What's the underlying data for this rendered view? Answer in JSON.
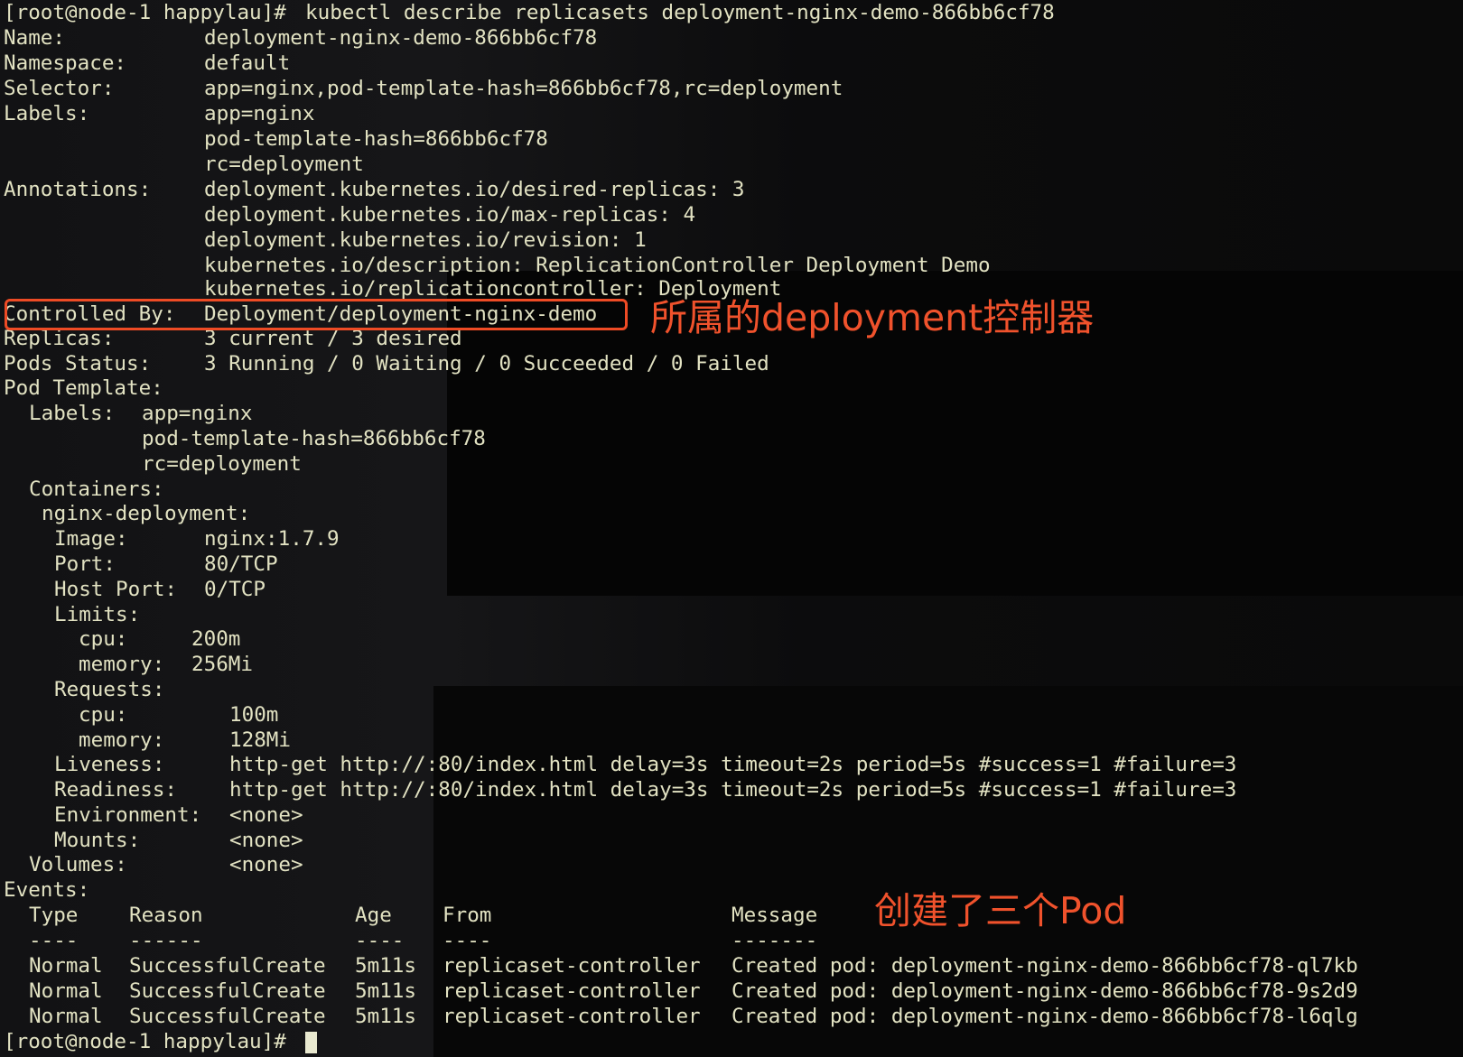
{
  "prompt": "[root@node-1 happylau]# ",
  "command": "kubectl describe replicasets deployment-nginx-demo-866bb6cf78",
  "name_key": "Name:",
  "name_val": "deployment-nginx-demo-866bb6cf78",
  "namespace_key": "Namespace:",
  "namespace_val": "default",
  "selector_key": "Selector:",
  "selector_val": "app=nginx,pod-template-hash=866bb6cf78,rc=deployment",
  "labels_key": "Labels:",
  "labels": [
    "app=nginx",
    "pod-template-hash=866bb6cf78",
    "rc=deployment"
  ],
  "annotations_key": "Annotations:",
  "annotations": [
    "deployment.kubernetes.io/desired-replicas: 3",
    "deployment.kubernetes.io/max-replicas: 4",
    "deployment.kubernetes.io/revision: 1",
    "kubernetes.io/description: ReplicationController Deployment Demo",
    "kubernetes.io/replicationcontroller: Deployment"
  ],
  "controlled_by_key": "Controlled By:",
  "controlled_by_val": "Deployment/deployment-nginx-demo",
  "replicas_key": "Replicas:",
  "replicas_val": "3 current / 3 desired",
  "pods_status_key": "Pods Status:",
  "pods_status_val": "3 Running / 0 Waiting / 0 Succeeded / 0 Failed",
  "pod_template_key": "Pod Template:",
  "pt_labels_key": "Labels:",
  "pt_labels": [
    "app=nginx",
    "pod-template-hash=866bb6cf78",
    "rc=deployment"
  ],
  "containers_key": "Containers:",
  "container_name": "nginx-deployment:",
  "image_key": "Image:",
  "image_val": "nginx:1.7.9",
  "port_key": "Port:",
  "port_val": "80/TCP",
  "host_port_key": "Host Port:",
  "host_port_val": "0/TCP",
  "limits_key": "Limits:",
  "limits_cpu_key": "cpu:",
  "limits_cpu_val": "200m",
  "limits_mem_key": "memory:",
  "limits_mem_val": "256Mi",
  "requests_key": "Requests:",
  "requests_cpu_key": "cpu:",
  "requests_cpu_val": "100m",
  "requests_mem_key": "memory:",
  "requests_mem_val": "128Mi",
  "liveness_key": "Liveness:",
  "liveness_val": "http-get http://:80/index.html delay=3s timeout=2s period=5s #success=1 #failure=3",
  "readiness_key": "Readiness:",
  "readiness_val": "http-get http://:80/index.html delay=3s timeout=2s period=5s #success=1 #failure=3",
  "environment_key": "Environment:",
  "environment_val": "<none>",
  "mounts_key": "Mounts:",
  "mounts_val": "<none>",
  "volumes_key": "Volumes:",
  "volumes_val": "<none>",
  "events_key": "Events:",
  "events_columns": [
    "Type",
    "Reason",
    "Age",
    "From",
    "Message"
  ],
  "events_dashes": [
    "----",
    "------",
    "----",
    "----",
    "-------"
  ],
  "events": [
    {
      "type": "Normal",
      "reason": "SuccessfulCreate",
      "age": "5m11s",
      "from": "replicaset-controller",
      "message": "Created pod: deployment-nginx-demo-866bb6cf78-ql7kb"
    },
    {
      "type": "Normal",
      "reason": "SuccessfulCreate",
      "age": "5m11s",
      "from": "replicaset-controller",
      "message": "Created pod: deployment-nginx-demo-866bb6cf78-9s2d9"
    },
    {
      "type": "Normal",
      "reason": "SuccessfulCreate",
      "age": "5m11s",
      "from": "replicaset-controller",
      "message": "Created pod: deployment-nginx-demo-866bb6cf78-l6qlg"
    }
  ],
  "annotation_controller": "所属的deployment控制器",
  "annotation_pods": "创建了三个Pod",
  "colors": {
    "text": "#e2e2c2",
    "annotation": "#f0522c",
    "background": "#111113"
  }
}
